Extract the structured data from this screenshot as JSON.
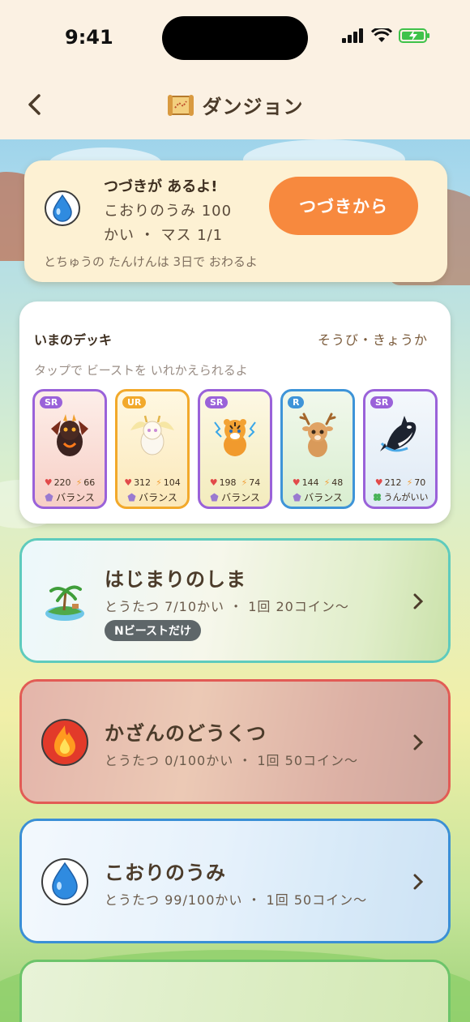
{
  "status_bar": {
    "time": "9:41"
  },
  "header": {
    "title": "ダンジョン",
    "title_icon": "scroll-map-icon",
    "back_icon": "chevron-left-icon"
  },
  "continue_card": {
    "icon": "water-drop-icon",
    "heading": "つづきが あるよ!",
    "line1": "こおりのうみ 100",
    "line2": "かい ・ マス 1/1",
    "button_label": "つづきから",
    "note": "とちゅうの たんけんは 3日で おわるよ",
    "button_color": "#f7893e"
  },
  "deck": {
    "title": "いまのデッキ",
    "link": "そうび・きょうか",
    "hint": "タップで ビーストを いれかえられるよ",
    "beasts": [
      {
        "rarity": "SR",
        "hp": "220",
        "atk": "66",
        "type": "バランス",
        "art": "fire-dragon-icon",
        "border": "#9a62d9",
        "bg": "#fbd9d4",
        "badge": "#9a62d9"
      },
      {
        "rarity": "UR",
        "hp": "312",
        "atk": "104",
        "type": "バランス",
        "art": "white-dragon-icon",
        "border": "#f2a92b",
        "bg": "#fdf0cf",
        "badge": "#f2a92b"
      },
      {
        "rarity": "SR",
        "hp": "198",
        "atk": "74",
        "type": "バランス",
        "art": "thunder-tiger-icon",
        "border": "#9a62d9",
        "bg": "#f6f0c8",
        "badge": "#9a62d9"
      },
      {
        "rarity": "R",
        "hp": "144",
        "atk": "48",
        "type": "バランス",
        "art": "deer-icon",
        "border": "#3e94d8",
        "bg": "#dff0d6",
        "badge": "#3e94d8"
      },
      {
        "rarity": "SR",
        "hp": "212",
        "atk": "70",
        "type": "うんがいい",
        "art": "orca-icon",
        "border": "#9a62d9",
        "bg": "#e3eef8",
        "badge": "#9a62d9"
      }
    ]
  },
  "dungeons": [
    {
      "name": "はじまりのしま",
      "meta": "とうたつ 7/10かい ・ 1回 20コイン〜",
      "tag": "Nビーストだけ",
      "icon": "island-icon",
      "border": "#5ecbbd"
    },
    {
      "name": "かざんのどうくつ",
      "meta": "とうたつ 0/100かい ・ 1回 50コイン〜",
      "icon": "fire-icon",
      "border": "#e25b55"
    },
    {
      "name": "こおりのうみ",
      "meta": "とうたつ 99/100かい ・ 1回 50コイン〜",
      "icon": "water-drop-icon",
      "border": "#3a8fd6"
    }
  ]
}
